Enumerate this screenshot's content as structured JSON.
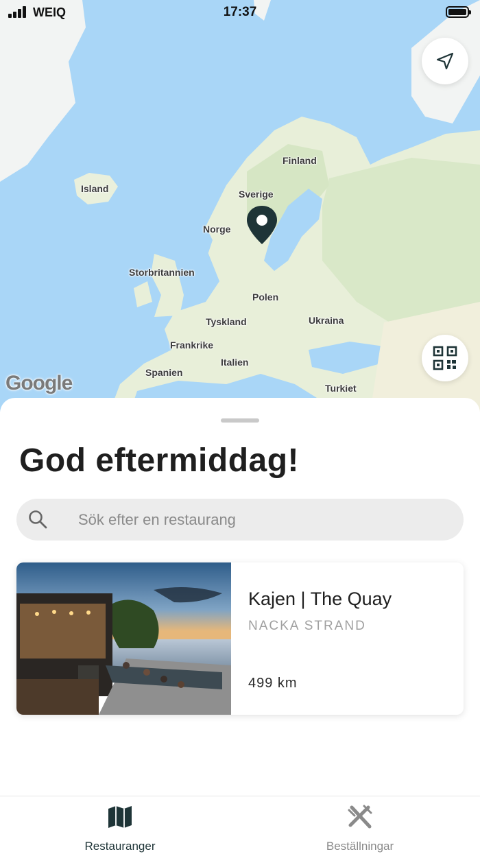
{
  "status_bar": {
    "carrier": "WEIQ",
    "time": "17:37"
  },
  "map": {
    "labels": {
      "island": "Island",
      "finland": "Finland",
      "sverige": "Sverige",
      "norge": "Norge",
      "storbritannien": "Storbritannien",
      "polen": "Polen",
      "tyskland": "Tyskland",
      "ukraina": "Ukraina",
      "frankrike": "Frankrike",
      "italien": "Italien",
      "spanien": "Spanien",
      "turkiet": "Turkiet"
    },
    "google_logo": "Google",
    "colors": {
      "water": "#a9d6f7",
      "land": "#e8efd9",
      "forest": "#cfe3b9",
      "pin": "#1e3437"
    }
  },
  "sheet": {
    "greeting": "God eftermiddag!",
    "search": {
      "placeholder": "Sök efter en restaurang",
      "value": ""
    },
    "restaurants": [
      {
        "name": "Kajen | The Quay",
        "area": "NACKA STRAND",
        "distance": "499 km"
      }
    ]
  },
  "tabbar": {
    "tabs": [
      {
        "label": "Restauranger",
        "icon": "map-icon",
        "active": true
      },
      {
        "label": "Beställningar",
        "icon": "utensils-icon",
        "active": false
      }
    ],
    "colors": {
      "active": "#1e3437",
      "inactive": "#8a8a8a"
    }
  }
}
